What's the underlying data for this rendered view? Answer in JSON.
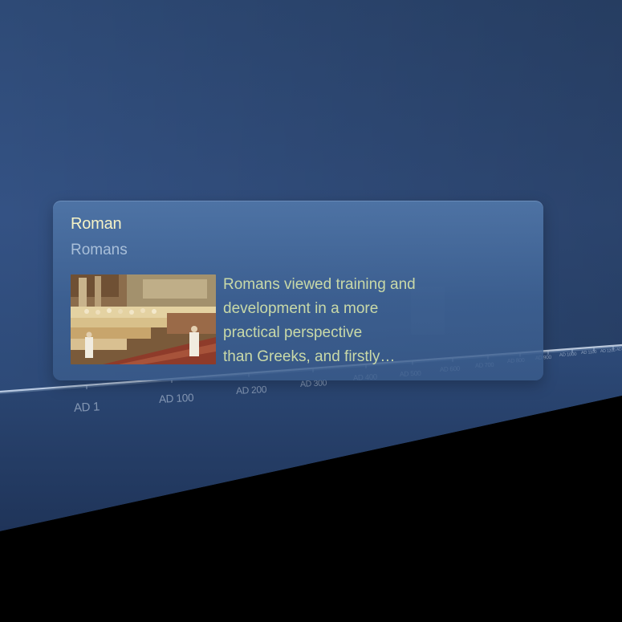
{
  "timeline": {
    "ticks": [
      {
        "label": "AD 1"
      },
      {
        "label": "AD 100"
      },
      {
        "label": "AD 200"
      },
      {
        "label": "AD 300"
      },
      {
        "label": "AD 400"
      },
      {
        "label": "AD 500"
      },
      {
        "label": "AD 600"
      },
      {
        "label": "AD 700"
      },
      {
        "label": "AD 800"
      },
      {
        "label": "AD 900"
      },
      {
        "label": "AD 1000"
      },
      {
        "label": "AD 1100"
      },
      {
        "label": "AD 1200"
      },
      {
        "label": "AD 1300"
      }
    ]
  },
  "card": {
    "title": "Roman",
    "subtitle": "Romans",
    "thumbnail_icon": "painting-thumbnail",
    "description_lines": [
      "Romans viewed training and",
      "development in a more",
      "practical perspective",
      "than Greeks, and firstly…"
    ]
  },
  "colors": {
    "background_top": "#2a4570",
    "background_bottom": "#1c3156",
    "card_title": "#f6f3c6",
    "card_subtitle": "#a9bfd9",
    "card_text": "#c9d9a8"
  }
}
